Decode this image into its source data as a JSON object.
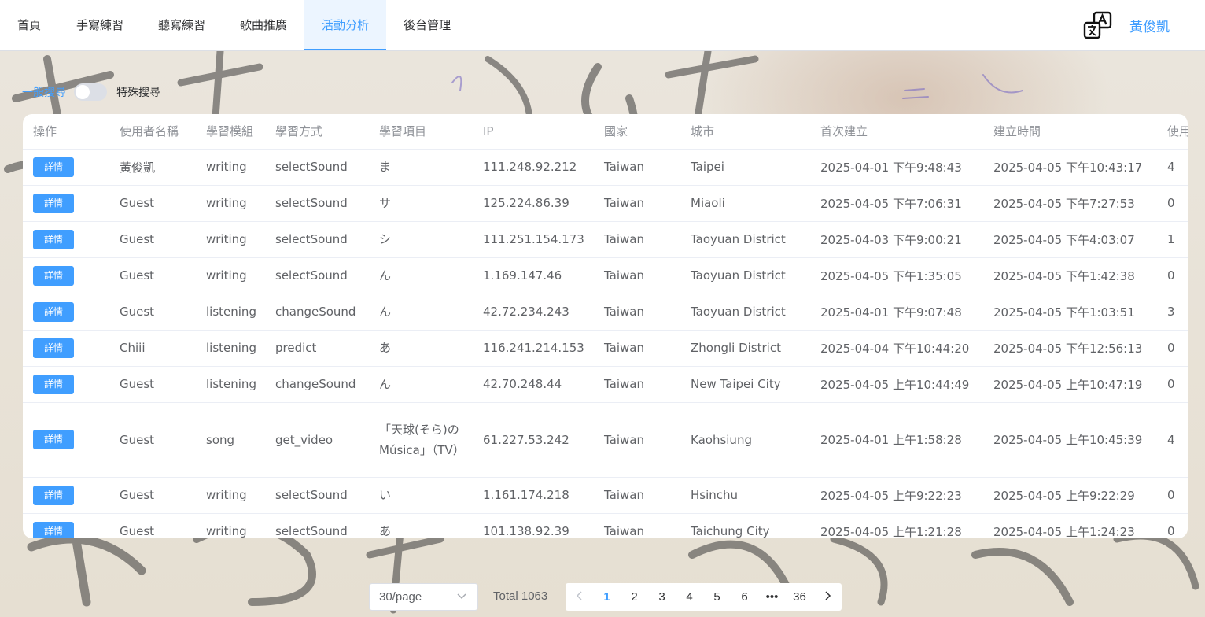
{
  "nav": {
    "items": [
      "首頁",
      "手寫練習",
      "聽寫練習",
      "歌曲推廣",
      "活動分析",
      "後台管理"
    ],
    "active_index": 4,
    "username": "黃俊凱",
    "translate_icon": "translate-icon"
  },
  "search": {
    "left_label": "一般搜尋",
    "right_label": "特殊搜尋",
    "special_enabled": false
  },
  "table": {
    "headers": [
      "操作",
      "使用者名稱",
      "學習模組",
      "學習方式",
      "學習項目",
      "IP",
      "國家",
      "城市",
      "首次建立",
      "建立時間",
      "使用"
    ],
    "detail_label": "詳情",
    "rows": [
      {
        "user": "黃俊凱",
        "module": "writing",
        "method": "selectSound",
        "item": "ま",
        "ip": "111.248.92.212",
        "country": "Taiwan",
        "city": "Taipei",
        "first": "2025-04-01 下午9:48:43",
        "created": "2025-04-05 下午10:43:17",
        "use": "4"
      },
      {
        "user": "Guest",
        "module": "writing",
        "method": "selectSound",
        "item": "サ",
        "ip": "125.224.86.39",
        "country": "Taiwan",
        "city": "Miaoli",
        "first": "2025-04-05 下午7:06:31",
        "created": "2025-04-05 下午7:27:53",
        "use": "0"
      },
      {
        "user": "Guest",
        "module": "writing",
        "method": "selectSound",
        "item": "シ",
        "ip": "111.251.154.173",
        "country": "Taiwan",
        "city": "Taoyuan District",
        "first": "2025-04-03 下午9:00:21",
        "created": "2025-04-05 下午4:03:07",
        "use": "1"
      },
      {
        "user": "Guest",
        "module": "writing",
        "method": "selectSound",
        "item": "ん",
        "ip": "1.169.147.46",
        "country": "Taiwan",
        "city": "Taoyuan District",
        "first": "2025-04-05 下午1:35:05",
        "created": "2025-04-05 下午1:42:38",
        "use": "0"
      },
      {
        "user": "Guest",
        "module": "listening",
        "method": "changeSound",
        "item": "ん",
        "ip": "42.72.234.243",
        "country": "Taiwan",
        "city": "Taoyuan District",
        "first": "2025-04-01 下午9:07:48",
        "created": "2025-04-05 下午1:03:51",
        "use": "3"
      },
      {
        "user": "Chiii",
        "module": "listening",
        "method": "predict",
        "item": "あ",
        "ip": "116.241.214.153",
        "country": "Taiwan",
        "city": "Zhongli District",
        "first": "2025-04-04 下午10:44:20",
        "created": "2025-04-05 下午12:56:13",
        "use": "0"
      },
      {
        "user": "Guest",
        "module": "listening",
        "method": "changeSound",
        "item": "ん",
        "ip": "42.70.248.44",
        "country": "Taiwan",
        "city": "New Taipei City",
        "first": "2025-04-05 上午10:44:49",
        "created": "2025-04-05 上午10:47:19",
        "use": "0"
      },
      {
        "user": "Guest",
        "module": "song",
        "method": "get_video",
        "item": "「天球(そら)のMúsica」（TV）",
        "ip": "61.227.53.242",
        "country": "Taiwan",
        "city": "Kaohsiung",
        "first": "2025-04-01 上午1:58:28",
        "created": "2025-04-05 上午10:45:39",
        "use": "4"
      },
      {
        "user": "Guest",
        "module": "writing",
        "method": "selectSound",
        "item": "い",
        "ip": "1.161.174.218",
        "country": "Taiwan",
        "city": "Hsinchu",
        "first": "2025-04-05 上午9:22:23",
        "created": "2025-04-05 上午9:22:29",
        "use": "0"
      },
      {
        "user": "Guest",
        "module": "writing",
        "method": "selectSound",
        "item": "あ",
        "ip": "101.138.92.39",
        "country": "Taiwan",
        "city": "Taichung City",
        "first": "2025-04-05 上午1:21:28",
        "created": "2025-04-05 上午1:24:23",
        "use": "0"
      }
    ]
  },
  "pagination": {
    "page_size": "30/page",
    "total": "Total 1063",
    "pages": [
      "1",
      "2",
      "3",
      "4",
      "5",
      "6",
      "•••",
      "36"
    ],
    "current": "1",
    "prev_icon": "chevron-left-icon",
    "next_icon": "chevron-right-icon",
    "dropdown_icon": "chevron-down-icon"
  },
  "colors": {
    "primary": "#409eff",
    "active_menu_bg": "#ecf5ff",
    "text": "#606266",
    "header_text": "#909399"
  }
}
